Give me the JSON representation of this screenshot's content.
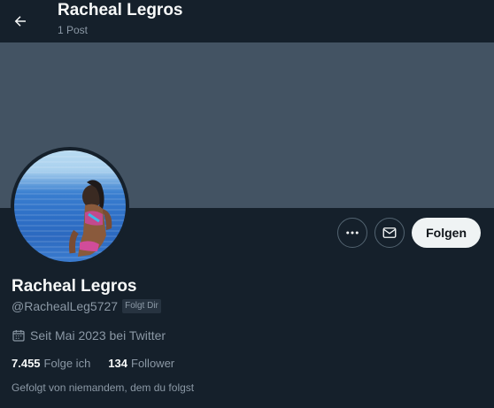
{
  "header": {
    "title": "Racheal Legros",
    "subtitle": "1 Post"
  },
  "profile": {
    "name": "Racheal Legros",
    "handle": "@RachealLeg5727",
    "follows_you_badge": "Folgt Dir",
    "joined": "Seit Mai 2023 bei Twitter",
    "following_count": "7.455",
    "following_label": "Folge ich",
    "followers_count": "134",
    "followers_label": "Follower",
    "followed_by": "Gefolgt von niemandem, dem du folgst"
  },
  "actions": {
    "follow_label": "Folgen",
    "more_icon": "more-icon",
    "message_icon": "mail-icon"
  },
  "colors": {
    "background": "#15202b",
    "banner": "#435363",
    "muted_text": "#8b98a5",
    "follow_button": "#eff3f4"
  }
}
